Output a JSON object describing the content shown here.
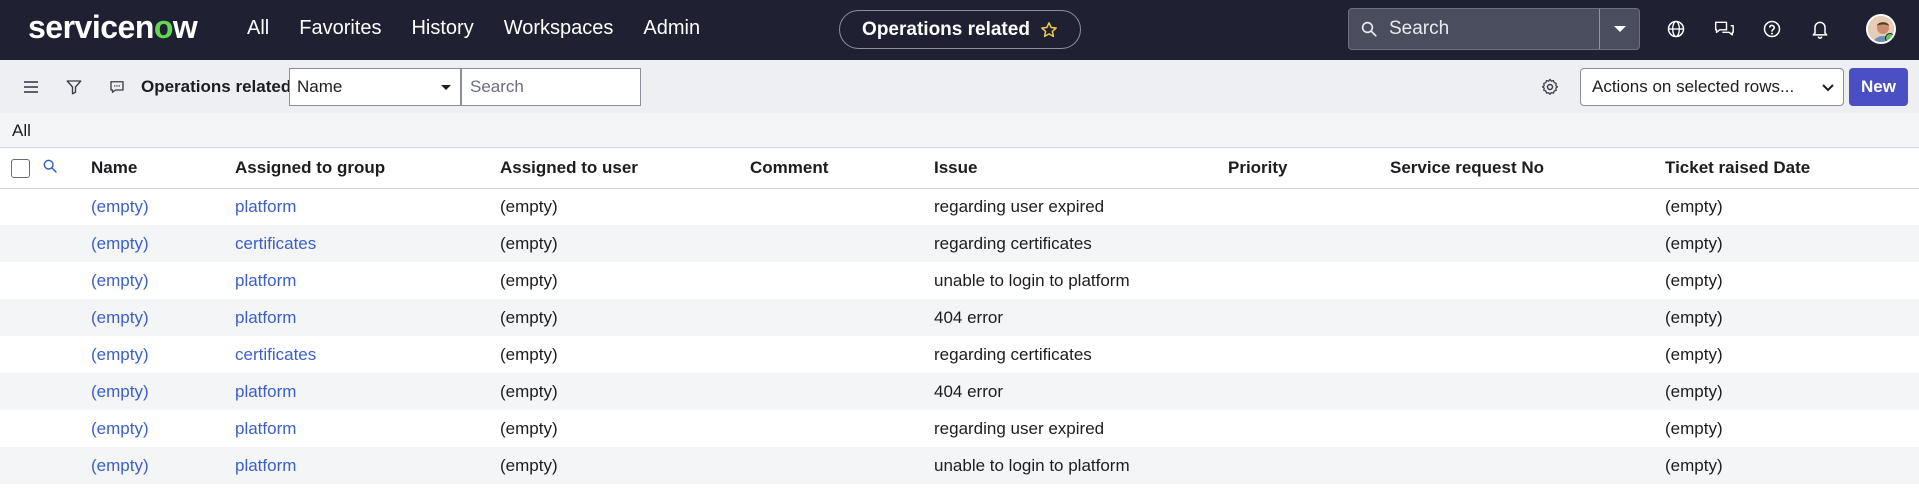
{
  "brand": {
    "logo_text_a": "servicen",
    "logo_text_o": "o",
    "logo_text_b": "w"
  },
  "nav": {
    "items": [
      "All",
      "Favorites",
      "History",
      "Workspaces",
      "Admin"
    ]
  },
  "context_pill": {
    "label": "Operations related",
    "icon": "star-icon"
  },
  "global_search": {
    "placeholder": "Search",
    "icon": "search-icon"
  },
  "top_icons": [
    "globe-icon",
    "chat-icon",
    "help-icon",
    "bell-icon"
  ],
  "toolbar": {
    "title": "Operations related",
    "field_select": "Name",
    "search_placeholder": "Search",
    "actions_select": "Actions on selected rows...",
    "new_label": "New"
  },
  "breadcrumb": {
    "label": "All"
  },
  "table": {
    "columns": [
      "Name",
      "Assigned to group",
      "Assigned to user",
      "Comment",
      "Issue",
      "Priority",
      "Service request No",
      "Ticket raised Date"
    ],
    "rows": [
      [
        "(empty)",
        "platform",
        "(empty)",
        "",
        "regarding user expired",
        "",
        "",
        "(empty)"
      ],
      [
        "(empty)",
        "certificates",
        "(empty)",
        "",
        "regarding certificates",
        "",
        "",
        "(empty)"
      ],
      [
        "(empty)",
        "platform",
        "(empty)",
        "",
        "unable to login to platform",
        "",
        "",
        "(empty)"
      ],
      [
        "(empty)",
        "platform",
        "(empty)",
        "",
        "404 error",
        "",
        "",
        "(empty)"
      ],
      [
        "(empty)",
        "certificates",
        "(empty)",
        "",
        "regarding certificates",
        "",
        "",
        "(empty)"
      ],
      [
        "(empty)",
        "platform",
        "(empty)",
        "",
        "404 error",
        "",
        "",
        "(empty)"
      ],
      [
        "(empty)",
        "platform",
        "(empty)",
        "",
        "regarding user expired",
        "",
        "",
        "(empty)"
      ],
      [
        "(empty)",
        "platform",
        "(empty)",
        "",
        "unable to login to platform",
        "",
        "",
        "(empty)"
      ]
    ]
  },
  "colors": {
    "nav_bg": "#1f2132",
    "accent": "#4b4fc4",
    "link": "#3b5fc8",
    "logo_o": "#62d84e"
  }
}
